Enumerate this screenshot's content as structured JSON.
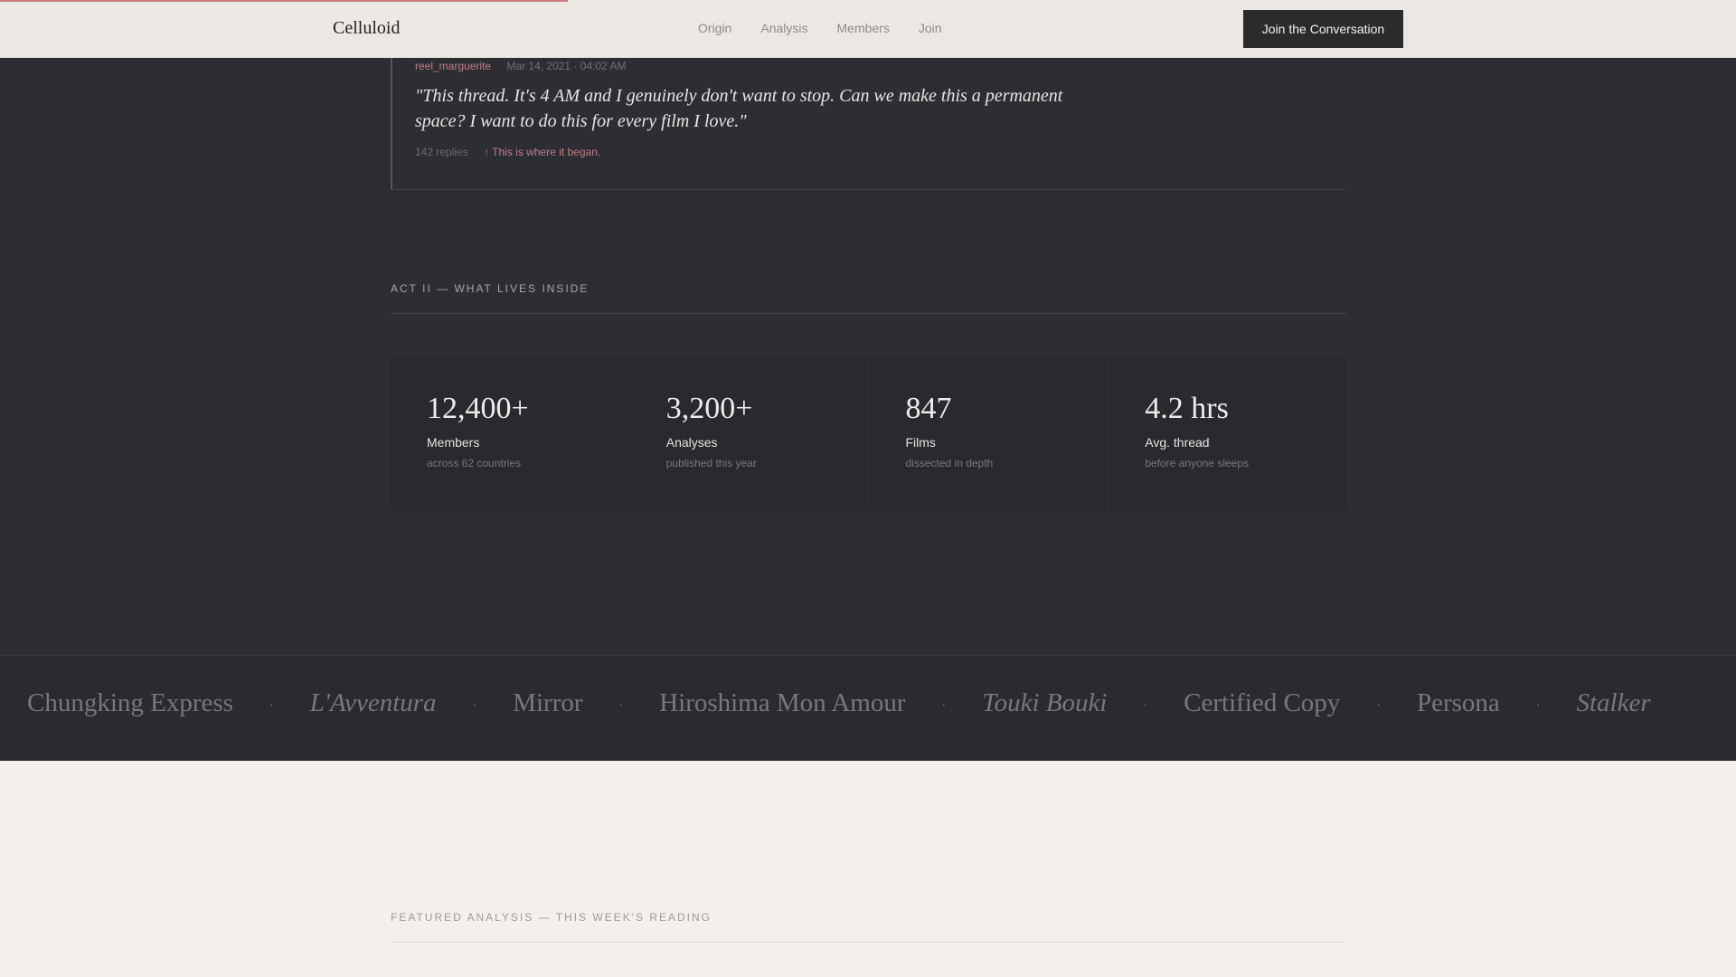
{
  "header": {
    "logo": "Celluloid",
    "nav": [
      "Origin",
      "Analysis",
      "Members",
      "Join"
    ],
    "cta": "Join the Conversation",
    "scroll_progress": 0.327
  },
  "thread_post": {
    "user": "reel_marguerite",
    "date": "Mar 14, 2021 · 04:02 AM",
    "quote": "\"This thread. It's 4 AM and I genuinely don't want to stop. Can we make this a permanent space? I want to do this for every film I love.\"",
    "replies": "142 replies",
    "origin_note": "↑ This is where it began."
  },
  "act_two": {
    "label": "ACT II — WHAT LIVES INSIDE",
    "stats": [
      {
        "number": "12,400+",
        "label": "Members",
        "sub": "across 62 countries"
      },
      {
        "number": "3,200+",
        "label": "Analyses",
        "sub": "published this year"
      },
      {
        "number": "847",
        "label": "Films",
        "sub": "dissected in depth"
      },
      {
        "number": "4.2 hrs",
        "label": "Avg. thread",
        "sub": "before anyone sleeps"
      }
    ]
  },
  "ticker": {
    "films": [
      {
        "title": "Chungking Express",
        "italic": false
      },
      {
        "title": "L'Avventura",
        "italic": true
      },
      {
        "title": "Mirror",
        "italic": false
      },
      {
        "title": "Hiroshima Mon Amour",
        "italic": false
      },
      {
        "title": "Touki Bouki",
        "italic": true
      },
      {
        "title": "Certified Copy",
        "italic": false
      },
      {
        "title": "Persona",
        "italic": false
      },
      {
        "title": "Stalker",
        "italic": true
      }
    ],
    "separator": "·"
  },
  "featured": {
    "label": "FEATURED ANALYSIS — THIS WEEK'S READING"
  },
  "colors": {
    "accent": "#c07c86",
    "dark_bg": "#2d2e33",
    "light_bg": "#f3efeb"
  }
}
